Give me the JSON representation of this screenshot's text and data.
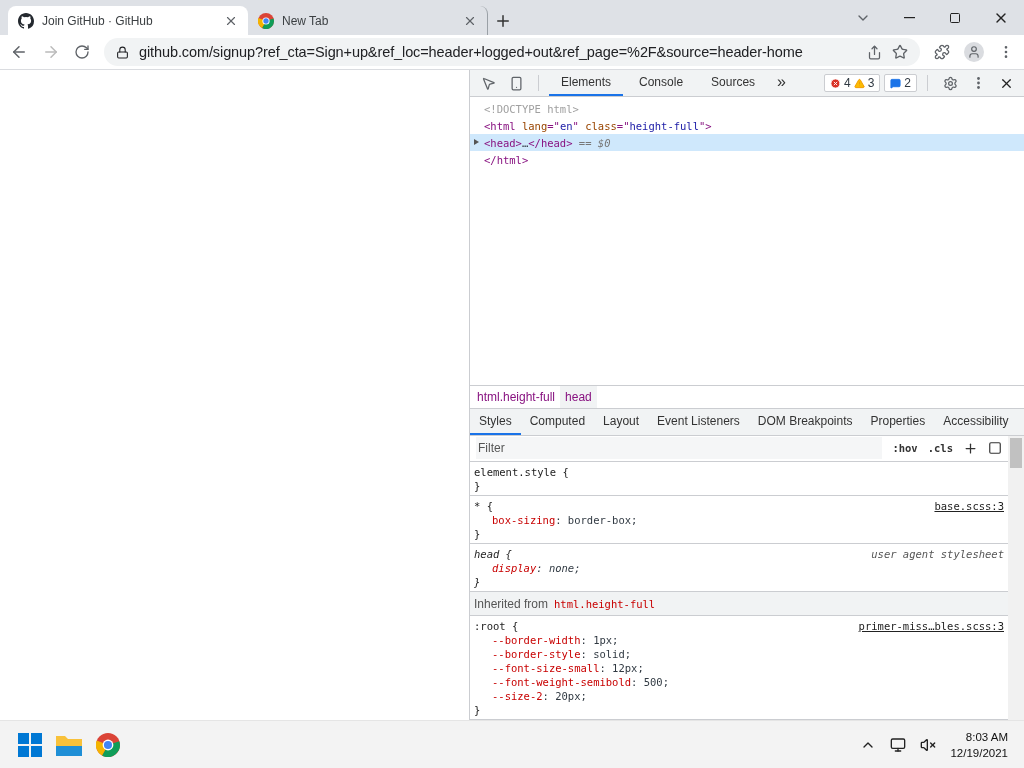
{
  "browser_tabs": [
    {
      "title": "Join GitHub · GitHub",
      "selected": true,
      "kind": "github"
    },
    {
      "title": "New Tab",
      "selected": false,
      "kind": "chrome"
    }
  ],
  "address_bar": {
    "url": "github.com/signup?ref_cta=Sign+up&ref_loc=header+logged+out&ref_page=%2F&source=header-home"
  },
  "devtools": {
    "tabs": [
      {
        "label": "Elements",
        "selected": true
      },
      {
        "label": "Console",
        "selected": false
      },
      {
        "label": "Sources",
        "selected": false
      }
    ],
    "more": "»",
    "errors": "4",
    "warnings": "3",
    "messages": "2",
    "dom_lines": [
      {
        "selected": false,
        "expandable": false,
        "tokens": [
          {
            "text": "<!DOCTYPE html>",
            "kind": "muted"
          }
        ]
      },
      {
        "selected": false,
        "expandable": false,
        "tokens": [
          {
            "text": "<html ",
            "kind": "tag"
          },
          {
            "text": "lang",
            "kind": "attr"
          },
          {
            "text": "=\"",
            "kind": "tag"
          },
          {
            "text": "en",
            "kind": "val"
          },
          {
            "text": "\" ",
            "kind": "tag"
          },
          {
            "text": "class",
            "kind": "attr"
          },
          {
            "text": "=\"",
            "kind": "tag"
          },
          {
            "text": "height-full",
            "kind": "val"
          },
          {
            "text": "\">",
            "kind": "tag"
          }
        ]
      },
      {
        "selected": true,
        "expandable": true,
        "tokens": [
          {
            "text": "<head>",
            "kind": "tag"
          },
          {
            "text": "…",
            "kind": "plain"
          },
          {
            "text": "</head>",
            "kind": "tag"
          },
          {
            "text": " == $0",
            "kind": "ref"
          }
        ]
      },
      {
        "selected": false,
        "expandable": false,
        "tokens": [
          {
            "text": "</html>",
            "kind": "tag"
          }
        ]
      }
    ],
    "breadcrumbs": [
      {
        "label": "html.height-full",
        "selected": false
      },
      {
        "label": "head",
        "selected": true
      }
    ],
    "panel_tabs": [
      {
        "label": "Styles",
        "selected": true
      },
      {
        "label": "Computed",
        "selected": false
      },
      {
        "label": "Layout",
        "selected": false
      },
      {
        "label": "Event Listeners",
        "selected": false
      },
      {
        "label": "DOM Breakpoints",
        "selected": false
      },
      {
        "label": "Properties",
        "selected": false
      },
      {
        "label": "Accessibility",
        "selected": false
      }
    ],
    "filter": {
      "placeholder": "Filter",
      "hov": ":hov",
      "cls": ".cls"
    },
    "rules": [
      {
        "kind": "rule",
        "italic": false,
        "selector": "element.style {",
        "close": "}"
      },
      {
        "kind": "rule",
        "italic": false,
        "selector": "* {",
        "source": "base.scss:3",
        "close": "}",
        "declarations": [
          {
            "prop": "box-sizing",
            "value": ": border-box;"
          }
        ]
      },
      {
        "kind": "rule",
        "italic": true,
        "selector": "head {",
        "source": "user agent stylesheet",
        "close": "}",
        "declarations": [
          {
            "prop": "display",
            "value": ": none;"
          }
        ]
      },
      {
        "kind": "inherited",
        "label": "Inherited from",
        "selector": "html.height-full"
      },
      {
        "kind": "rule",
        "italic": false,
        "selector": ":root {",
        "source": "primer-miss…bles.scss:3",
        "close": "}",
        "declarations": [
          {
            "prop": "--border-width",
            "value": ": 1px;"
          },
          {
            "prop": "--border-style",
            "value": ": solid;"
          },
          {
            "prop": "--font-size-small",
            "value": ": 12px;"
          },
          {
            "prop": "--font-weight-semibold",
            "value": ": 500;"
          },
          {
            "prop": "--size-2",
            "value": ": 20px;"
          }
        ]
      }
    ]
  },
  "taskbar": {
    "time": "8:03 AM",
    "date": "12/19/2021"
  }
}
